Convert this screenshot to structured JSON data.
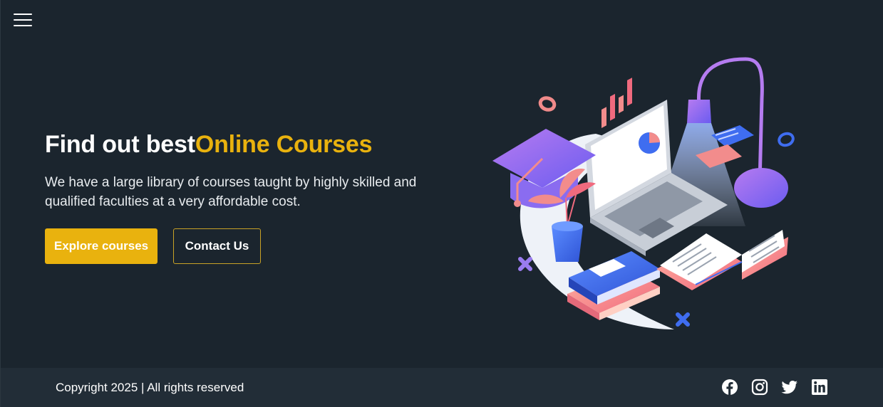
{
  "header": {
    "menu_icon": "hamburger-menu-icon"
  },
  "hero": {
    "title_main": "Find out best",
    "title_accent": "Online Courses",
    "description": "We have a large library of courses taught by highly skilled and qualified faculties at a very affordable cost.",
    "primary_button": "Explore courses",
    "secondary_button": "Contact Us",
    "illustration": "online-learning-illustration"
  },
  "footer": {
    "copyright": "Copyright 2025 | All rights reserved",
    "social_icons": [
      "facebook-icon",
      "instagram-icon",
      "twitter-icon",
      "linkedin-icon"
    ]
  },
  "colors": {
    "background": "#1b252e",
    "footer_background": "#222d37",
    "accent": "#e9b20e",
    "text": "#ffffff"
  }
}
